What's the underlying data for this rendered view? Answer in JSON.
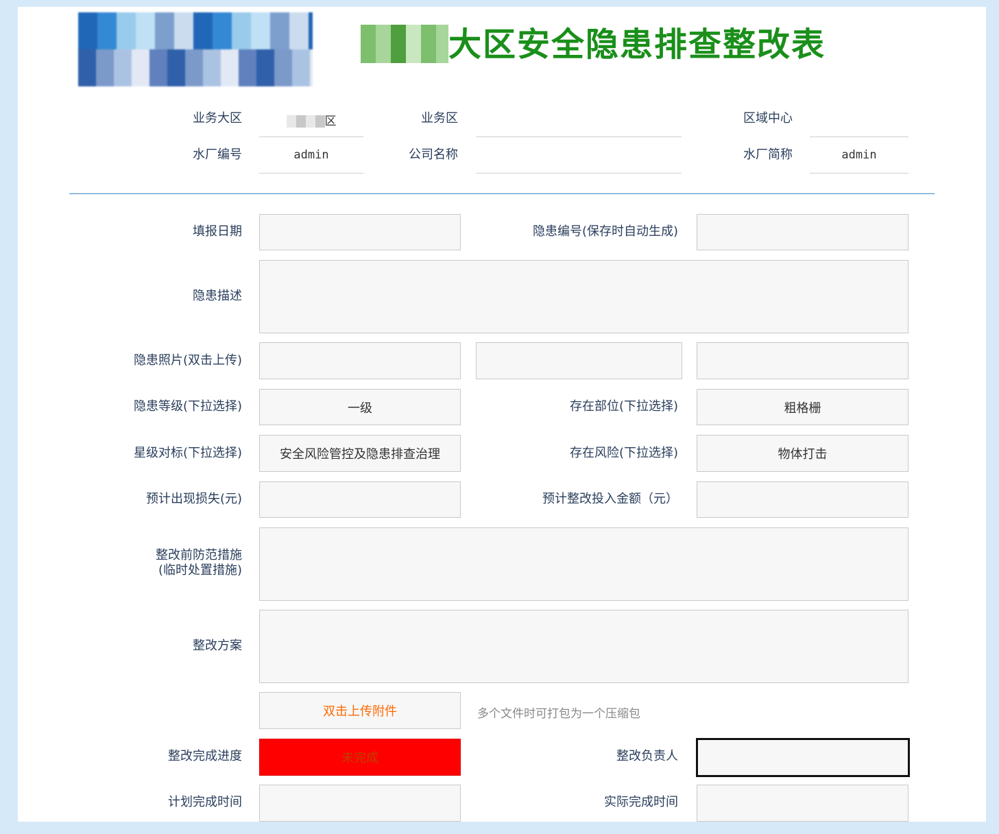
{
  "header": {
    "title_suffix": "大区安全隐患排查整改表"
  },
  "info": {
    "biz_region_label": "业务大区",
    "biz_region_value": "区",
    "biz_area_label": "业务区",
    "biz_area_value": "",
    "region_center_label": "区域中心",
    "region_center_value": "",
    "plant_no_label": "水厂编号",
    "plant_no_value": "admin",
    "company_label": "公司名称",
    "company_value": "",
    "plant_short_label": "水厂简称",
    "plant_short_value": "admin"
  },
  "form": {
    "report_date_label": "填报日期",
    "report_date_value": "",
    "hazard_no_label": "隐患编号(保存时自动生成)",
    "hazard_no_value": "",
    "description_label": "隐患描述",
    "description_value": "",
    "photo_label": "隐患照片(双击上传)",
    "level_label": "隐患等级(下拉选择)",
    "level_value": "一级",
    "location_label": "存在部位(下拉选择)",
    "location_value": "粗格栅",
    "star_label": "星级对标(下拉选择)",
    "star_value": "安全风险管控及隐患排查治理",
    "risk_label": "存在风险(下拉选择)",
    "risk_value": "物体打击",
    "loss_label": "预计出现损失(元)",
    "loss_value": "",
    "invest_label": "预计整改投入金额（元）",
    "invest_value": "",
    "prevent_label_1": "整改前防范措施",
    "prevent_label_2": "(临时处置措施)",
    "prevent_value": "",
    "plan_label": "整改方案",
    "plan_value": "",
    "upload_button": "双击上传附件",
    "upload_hint": "多个文件时可打包为一个压缩包",
    "progress_label": "整改完成进度",
    "progress_value": "未完成",
    "progress_color": "#ff0000",
    "owner_label": "整改负责人",
    "owner_value": "",
    "planned_time_label": "计划完成时间",
    "planned_time_value": "",
    "actual_time_label": "实际完成时间",
    "actual_time_value": ""
  }
}
